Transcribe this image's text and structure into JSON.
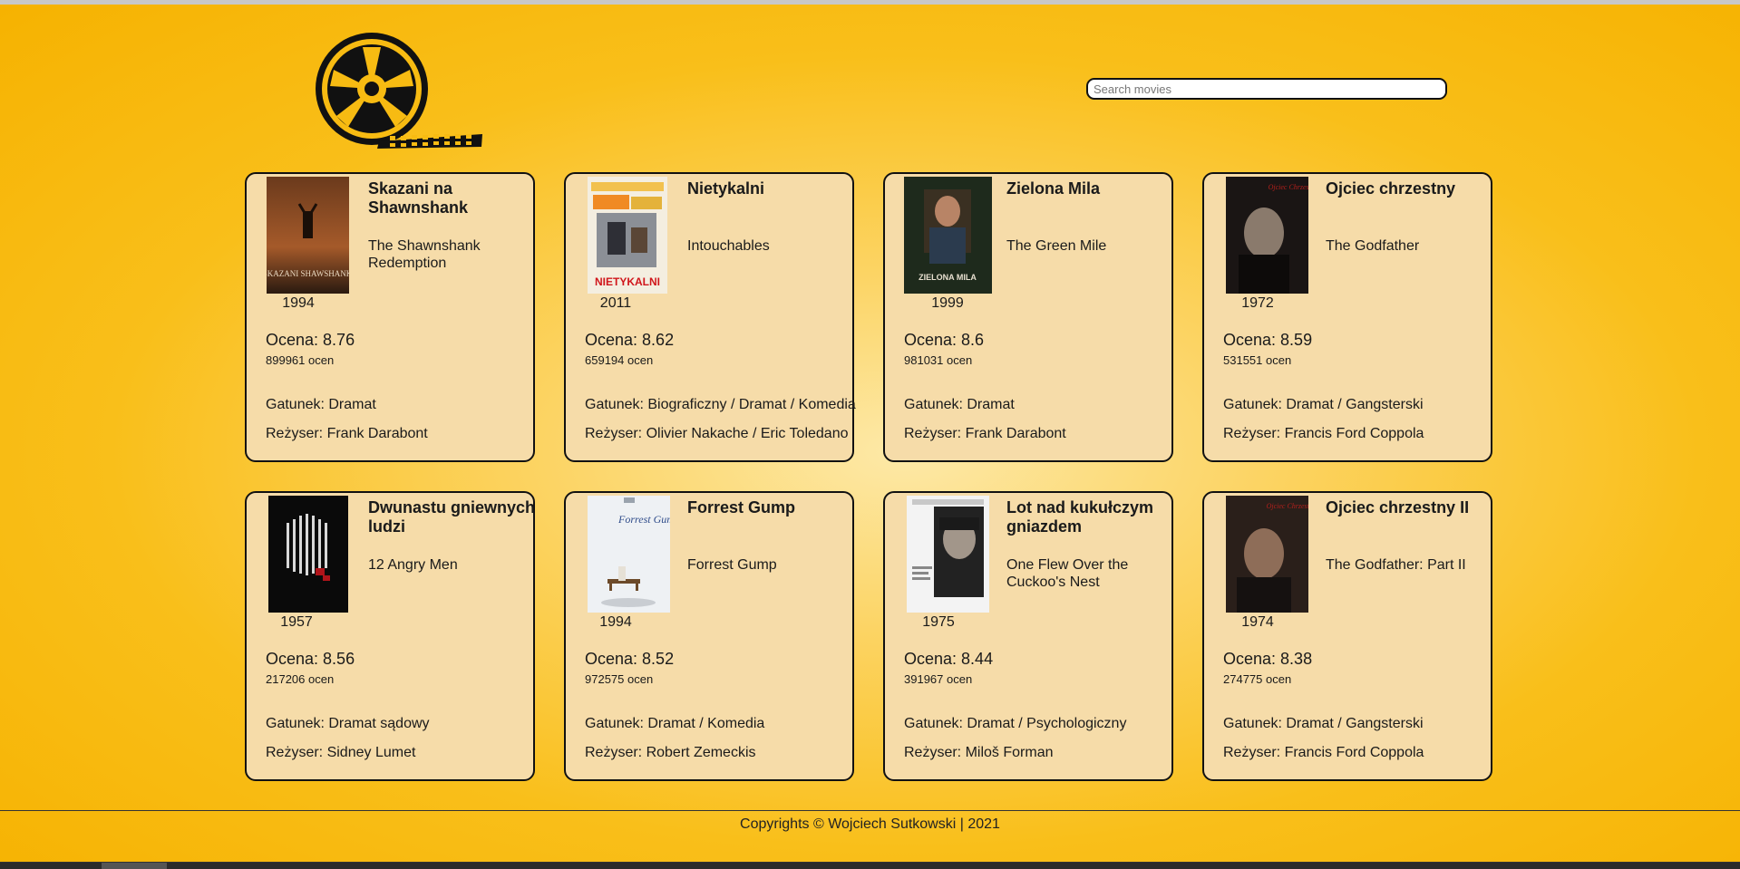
{
  "header": {
    "search": {
      "placeholder": "Search movies",
      "value": ""
    }
  },
  "labels": {
    "rating_prefix": "Ocena: ",
    "votes_suffix": " ocen",
    "genre_prefix": "Gatunek: ",
    "director_prefix": "Reżyser: "
  },
  "movies": [
    {
      "title": "Skazani na Shawnshank",
      "original_title": "The Shawnshank Redemption",
      "year": "1994",
      "rating": "8.76",
      "votes": "899961",
      "genre": "Dramat",
      "director": "Frank Darabont",
      "poster_text": "SKAZANI SHAWSHANK"
    },
    {
      "title": "Nietykalni",
      "original_title": "Intouchables",
      "year": "2011",
      "rating": "8.62",
      "votes": "659194",
      "genre": "Biograficzny / Dramat / Komedia",
      "director": "Olivier Nakache / Eric Toledano",
      "poster_text": "NIETYKALNI"
    },
    {
      "title": "Zielona Mila",
      "original_title": "The Green Mile",
      "year": "1999",
      "rating": "8.6",
      "votes": "981031",
      "genre": "Dramat",
      "director": "Frank Darabont",
      "poster_text": "ZIELONA MILA"
    },
    {
      "title": "Ojciec chrzestny",
      "original_title": "The Godfather",
      "year": "1972",
      "rating": "8.59",
      "votes": "531551",
      "genre": "Dramat / Gangsterski",
      "director": "Francis Ford Coppola",
      "poster_text": "Ojciec Chrzestny"
    },
    {
      "title": "Dwunastu gniewnych ludzi",
      "original_title": "12 Angry Men",
      "year": "1957",
      "rating": "8.56",
      "votes": "217206",
      "genre": "Dramat sądowy",
      "director": "Sidney Lumet",
      "poster_text": ""
    },
    {
      "title": "Forrest Gump",
      "original_title": "Forrest Gump",
      "year": "1994",
      "rating": "8.52",
      "votes": "972575",
      "genre": "Dramat / Komedia",
      "director": "Robert Zemeckis",
      "poster_text": "Forrest Gump"
    },
    {
      "title": "Lot nad kukułczym gniazdem",
      "original_title": "One Flew Over the Cuckoo's Nest",
      "year": "1975",
      "rating": "8.44",
      "votes": "391967",
      "genre": "Dramat / Psychologiczny",
      "director": "Miloš Forman",
      "poster_text": ""
    },
    {
      "title": "Ojciec chrzestny II",
      "original_title": "The Godfather: Part II",
      "year": "1974",
      "rating": "8.38",
      "votes": "274775",
      "genre": "Dramat / Gangsterski",
      "director": "Francis Ford Coppola",
      "poster_text": "Ojciec Chrzestny"
    }
  ],
  "footer": {
    "text": "Copyrights © Wojciech Sutkowski | 2021"
  },
  "colors": {
    "background": "#f9bf1a",
    "card": "#f6dca9",
    "border": "#111111"
  },
  "icons": {
    "logo": "film-reel-icon"
  }
}
